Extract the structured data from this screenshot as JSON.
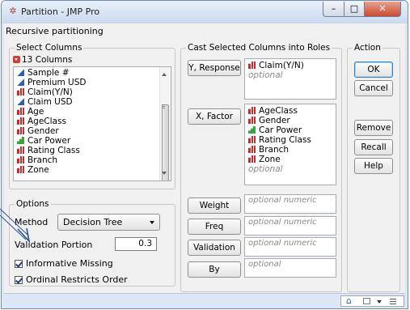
{
  "window": {
    "title": "Partition - JMP Pro",
    "controls": {
      "minimize": "–",
      "maximize": "□",
      "close": "✕"
    }
  },
  "subtitle": "Recursive partitioning",
  "select_columns": {
    "legend": "Select Columns",
    "header": "13 Columns",
    "items": [
      {
        "label": "Sample #",
        "type": "continuous"
      },
      {
        "label": "Premium USD",
        "type": "continuous"
      },
      {
        "label": "Claim(Y/N)",
        "type": "nominal"
      },
      {
        "label": "Claim USD",
        "type": "continuous"
      },
      {
        "label": "Age",
        "type": "nominal"
      },
      {
        "label": "AgeClass",
        "type": "nominal"
      },
      {
        "label": "Gender",
        "type": "nominal"
      },
      {
        "label": "Car Power",
        "type": "ordinal"
      },
      {
        "label": "Rating Class",
        "type": "nominal"
      },
      {
        "label": "Branch",
        "type": "nominal"
      },
      {
        "label": "Zone",
        "type": "nominal"
      }
    ]
  },
  "roles": {
    "legend": "Cast Selected Columns into Roles",
    "y": {
      "button": "Y, Response",
      "values": [
        "Claim(Y/N)"
      ],
      "placeholder": "optional"
    },
    "x": {
      "button": "X, Factor",
      "values": [
        "AgeClass",
        "Gender",
        "Car Power",
        "Rating Class",
        "Branch",
        "Zone"
      ],
      "types": [
        "nominal",
        "nominal",
        "ordinal",
        "nominal",
        "nominal",
        "nominal"
      ],
      "placeholder": "optional"
    },
    "weight": {
      "button": "Weight",
      "placeholder": "optional numeric"
    },
    "freq": {
      "button": "Freq",
      "placeholder": "optional numeric"
    },
    "validation": {
      "button": "Validation",
      "placeholder": "optional numeric"
    },
    "by": {
      "button": "By",
      "placeholder": "optional"
    }
  },
  "action": {
    "legend": "Action",
    "ok": "OK",
    "cancel": "Cancel",
    "remove": "Remove",
    "recall": "Recall",
    "help": "Help"
  },
  "options": {
    "legend": "Options",
    "method_label": "Method",
    "method_value": "Decision Tree",
    "validation_label": "Validation Portion",
    "validation_value": "0.3",
    "informative_missing": {
      "label": "Informative Missing",
      "checked": true
    },
    "ordinal_restricts": {
      "label": "Ordinal Restricts Order",
      "checked": true
    }
  },
  "colors": {
    "nominal": "#c42b2b",
    "continuous": "#2f5fb0",
    "ordinal": "#3aa53a",
    "annotation_arrow": "#2d4f8f",
    "titlebar": "#c9d9ee"
  }
}
